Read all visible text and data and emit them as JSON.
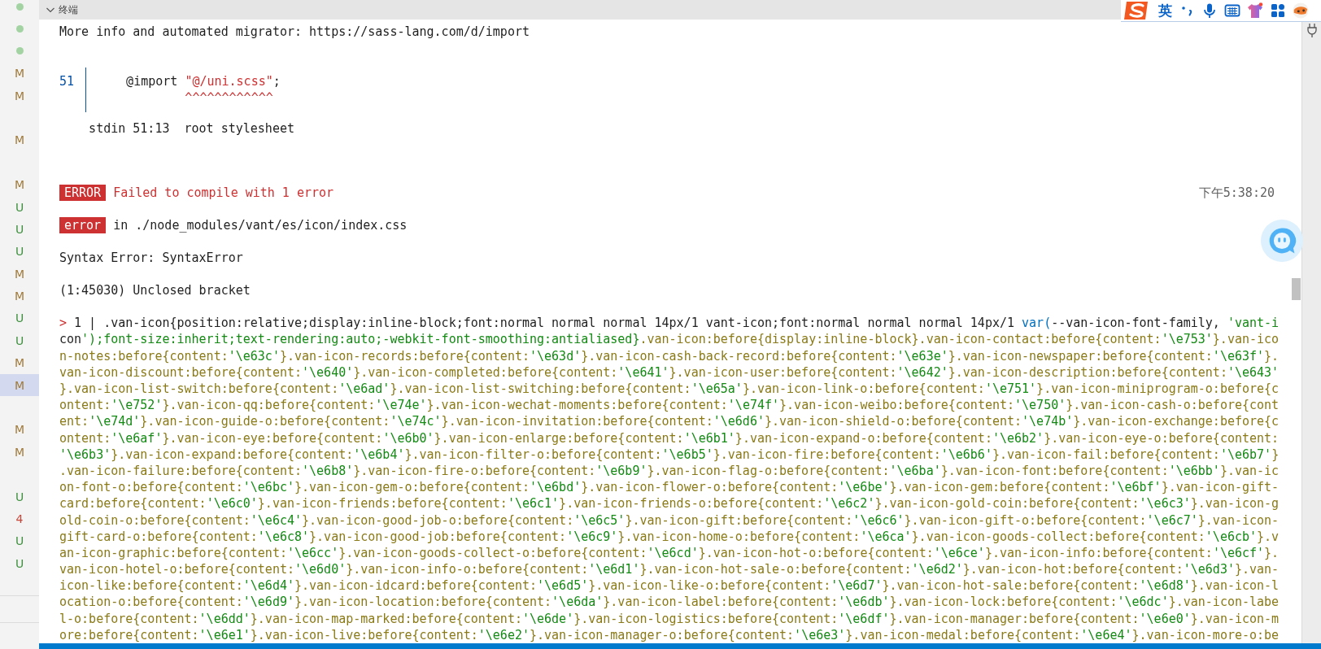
{
  "gutter": [
    {
      "kind": "dot",
      "color": "#a3d3a3"
    },
    {
      "kind": "dot",
      "color": "#a3d3a3"
    },
    {
      "kind": "dot",
      "color": "#a3d3a3"
    },
    {
      "kind": "letter",
      "text": "M",
      "color": "#a07a3a",
      "selected": false
    },
    {
      "kind": "letter",
      "text": "M",
      "color": "#a07a3a",
      "selected": false
    },
    {
      "kind": "gap"
    },
    {
      "kind": "letter",
      "text": "M",
      "color": "#a07a3a",
      "selected": false
    },
    {
      "kind": "gap"
    },
    {
      "kind": "letter",
      "text": "M",
      "color": "#a07a3a",
      "selected": false
    },
    {
      "kind": "letter",
      "text": "U",
      "color": "#3f8f3f",
      "selected": false
    },
    {
      "kind": "letter",
      "text": "U",
      "color": "#3f8f3f",
      "selected": false
    },
    {
      "kind": "letter",
      "text": "U",
      "color": "#3f8f3f",
      "selected": false
    },
    {
      "kind": "letter",
      "text": "M",
      "color": "#a07a3a",
      "selected": false
    },
    {
      "kind": "letter",
      "text": "M",
      "color": "#a07a3a",
      "selected": false
    },
    {
      "kind": "letter",
      "text": "U",
      "color": "#3f8f3f",
      "selected": false
    },
    {
      "kind": "letter",
      "text": "U",
      "color": "#3f8f3f",
      "selected": false
    },
    {
      "kind": "letter",
      "text": "M",
      "color": "#a07a3a",
      "selected": false
    },
    {
      "kind": "letter",
      "text": "M",
      "color": "#a07a3a",
      "selected": true
    },
    {
      "kind": "gap"
    },
    {
      "kind": "letter",
      "text": "M",
      "color": "#a07a3a",
      "selected": false
    },
    {
      "kind": "letter",
      "text": "M",
      "color": "#a07a3a",
      "selected": false
    },
    {
      "kind": "gap"
    },
    {
      "kind": "letter",
      "text": "U",
      "color": "#3f8f3f",
      "selected": false
    },
    {
      "kind": "letter",
      "text": "4",
      "color": "#c4473b",
      "selected": false
    },
    {
      "kind": "letter",
      "text": "U",
      "color": "#3f8f3f",
      "selected": false
    },
    {
      "kind": "letter",
      "text": "U",
      "color": "#3f8f3f",
      "selected": false
    }
  ],
  "panel": {
    "title": "终端",
    "expanded": true
  },
  "ime_toolbar": {
    "language": "英"
  },
  "output": [
    {
      "kind": "text",
      "text": "More info and automated migrator: https://sass-lang.com/d/import"
    },
    {
      "kind": "snippet",
      "line_number": "51",
      "code": [
        {
          "text": "    @import ",
          "kind": "plain"
        },
        {
          "text": "\"@/uni.scss\"",
          "kind": "string"
        },
        {
          "text": ";",
          "kind": "plain"
        }
      ],
      "marker": "^^^^^^^^^^^^"
    },
    {
      "kind": "location",
      "text": "    stdin 51:13  root stylesheet"
    },
    {
      "kind": "badge",
      "badge": "ERROR",
      "message": "Failed to compile with 1 error",
      "highlighted": true,
      "timestamp": "下午5:38:20"
    },
    {
      "kind": "badge",
      "badge": "error",
      "message": "in ./node_modules/vant/es/icon/index.css",
      "highlighted": false
    },
    {
      "kind": "text",
      "text": "Syntax Error: SyntaxError"
    },
    {
      "kind": "text",
      "text": "(1:45030) Unclosed bracket"
    },
    {
      "kind": "source",
      "marker": ">",
      "gutter": "1 |",
      "lines": [
        [
          {
            "text": ".van-icon{position:relative;display:inline-block;font:normal normal normal 14px/1 vant-icon;font:normal normal normal 14px/1 ",
            "kind": "plain"
          },
          {
            "text": "var(",
            "kind": "func"
          },
          {
            "text": "--van-icon-font-family, 'vant-i",
            "kind": "plain"
          }
        ],
        [
          {
            "text": "con');font-size:inherit;text-rendering:auto;-webkit-font-smoothing:antialiased}",
            "kind": "plain"
          },
          {
            "text": ".van-icon:before{display:inline-block}.van-icon-contact:before{content:'\\e753'}.van-ico",
            "kind": "css"
          }
        ],
        [
          {
            "text": "n-notes:before{content:'\\e63c'}.van-icon-records:before{content:'\\e63d'}.van-icon-cash-back-record:before{content:'\\e63e'}.van-icon-newspaper:before{content:'\\e63f'}.",
            "kind": "css"
          }
        ],
        [
          {
            "text": "van-icon-discount:before{content:'\\e640'}.van-icon-completed:before{content:'\\e641'}.van-icon-user:before{content:'\\e642'}.van-icon-description:before{content:'\\e643'",
            "kind": "css"
          }
        ],
        [
          {
            "text": "}.van-icon-list-switch:before{content:'\\e6ad'}.van-icon-list-switching:before{content:'\\e65a'}.van-icon-link-o:before{content:'\\e751'}.van-icon-miniprogram-o:before{c",
            "kind": "css"
          }
        ],
        [
          {
            "text": "ontent:'\\e752'}.van-icon-qq:before{content:'\\e74e'}.van-icon-wechat-moments:before{content:'\\e74f'}.van-icon-weibo:before{content:'\\e750'}.van-icon-cash-o:before{cont",
            "kind": "css"
          }
        ],
        [
          {
            "text": "ent:'\\e74d'}.van-icon-guide-o:before{content:'\\e74c'}.van-icon-invitation:before{content:'\\e6d6'}.van-icon-shield-o:before{content:'\\e74b'}.van-icon-exchange:before{c",
            "kind": "css"
          }
        ],
        [
          {
            "text": "ontent:'\\e6af'}.van-icon-eye:before{content:'\\e6b0'}.van-icon-enlarge:before{content:'\\e6b1'}.van-icon-expand-o:before{content:'\\e6b2'}.van-icon-eye-o:before{content:",
            "kind": "css"
          }
        ],
        [
          {
            "text": "'\\e6b3'}.van-icon-expand:before{content:'\\e6b4'}.van-icon-filter-o:before{content:'\\e6b5'}.van-icon-fire:before{content:'\\e6b6'}.van-icon-fail:before{content:'\\e6b7'}",
            "kind": "css"
          }
        ],
        [
          {
            "text": ".van-icon-failure:before{content:'\\e6b8'}.van-icon-fire-o:before{content:'\\e6b9'}.van-icon-flag-o:before{content:'\\e6ba'}.van-icon-font:before{content:'\\e6bb'}.van-ic",
            "kind": "css"
          }
        ],
        [
          {
            "text": "on-font-o:before{content:'\\e6bc'}.van-icon-gem-o:before{content:'\\e6bd'}.van-icon-flower-o:before{content:'\\e6be'}.van-icon-gem:before{content:'\\e6bf'}.van-icon-gift-",
            "kind": "css"
          }
        ],
        [
          {
            "text": "card:before{content:'\\e6c0'}.van-icon-friends:before{content:'\\e6c1'}.van-icon-friends-o:before{content:'\\e6c2'}.van-icon-gold-coin:before{content:'\\e6c3'}.van-icon-g",
            "kind": "css"
          }
        ],
        [
          {
            "text": "old-coin-o:before{content:'\\e6c4'}.van-icon-good-job-o:before{content:'\\e6c5'}.van-icon-gift:before{content:'\\e6c6'}.van-icon-gift-o:before{content:'\\e6c7'}.van-icon-",
            "kind": "css"
          }
        ],
        [
          {
            "text": "gift-card-o:before{content:'\\e6c8'}.van-icon-good-job:before{content:'\\e6c9'}.van-icon-home-o:before{content:'\\e6ca'}.van-icon-goods-collect:before{content:'\\e6cb'}.v",
            "kind": "css"
          }
        ],
        [
          {
            "text": "an-icon-graphic:before{content:'\\e6cc'}.van-icon-goods-collect-o:before{content:'\\e6cd'}.van-icon-hot-o:before{content:'\\e6ce'}.van-icon-info:before{content:'\\e6cf'}.",
            "kind": "css"
          }
        ],
        [
          {
            "text": "van-icon-hotel-o:before{content:'\\e6d0'}.van-icon-info-o:before{content:'\\e6d1'}.van-icon-hot-sale-o:before{content:'\\e6d2'}.van-icon-hot:before{content:'\\e6d3'}.van-",
            "kind": "css"
          }
        ],
        [
          {
            "text": "icon-like:before{content:'\\e6d4'}.van-icon-idcard:before{content:'\\e6d5'}.van-icon-like-o:before{content:'\\e6d7'}.van-icon-hot-sale:before{content:'\\e6d8'}.van-icon-l",
            "kind": "css"
          }
        ],
        [
          {
            "text": "ocation-o:before{content:'\\e6d9'}.van-icon-location:before{content:'\\e6da'}.van-icon-label:before{content:'\\e6db'}.van-icon-lock:before{content:'\\e6dc'}.van-icon-labe",
            "kind": "css"
          }
        ],
        [
          {
            "text": "l-o:before{content:'\\e6dd'}.van-icon-map-marked:before{content:'\\e6de'}.van-icon-logistics:before{content:'\\e6df'}.van-icon-manager:before{content:'\\e6e0'}.van-icon-m",
            "kind": "css"
          }
        ],
        [
          {
            "text": "ore:before{content:'\\e6e1'}.van-icon-live:before{content:'\\e6e2'}.van-icon-manager-o:before{content:'\\e6e3'}.van-icon-medal:before{content:'\\e6e4'}.van-icon-more-o:be",
            "kind": "css"
          }
        ]
      ]
    }
  ]
}
